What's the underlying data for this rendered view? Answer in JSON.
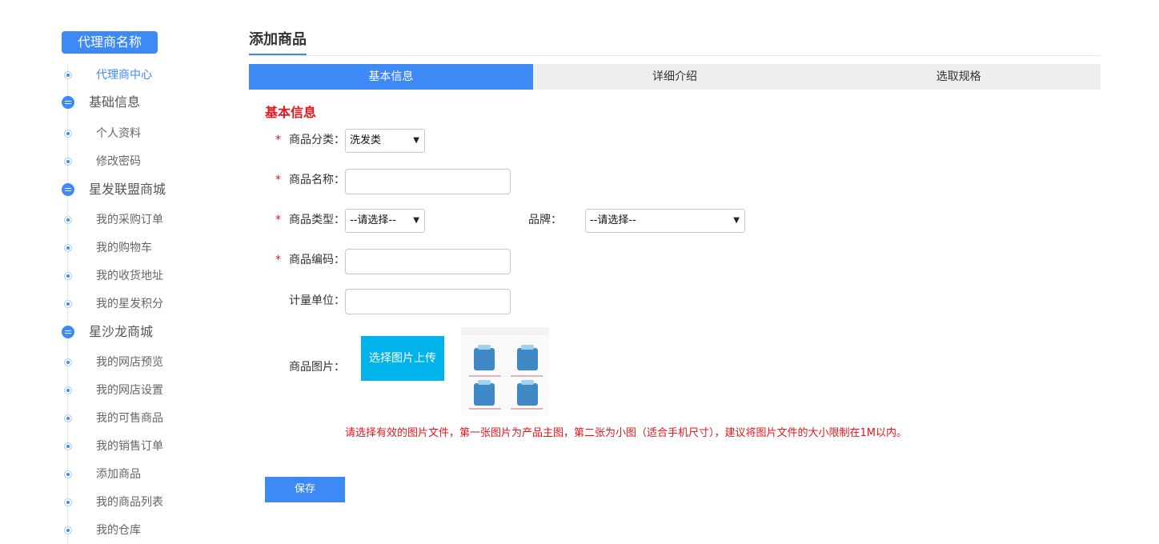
{
  "sidebar": {
    "agent_name": "代理商名称",
    "items": [
      {
        "type": "sub",
        "label": "代理商中心",
        "active": true
      },
      {
        "type": "section",
        "label": "基础信息"
      },
      {
        "type": "sub",
        "label": "个人资料"
      },
      {
        "type": "sub",
        "label": "修改密码"
      },
      {
        "type": "section",
        "label": "星发联盟商城"
      },
      {
        "type": "sub",
        "label": "我的采购订单"
      },
      {
        "type": "sub",
        "label": "我的购物车"
      },
      {
        "type": "sub",
        "label": "我的收货地址"
      },
      {
        "type": "sub",
        "label": "我的星发积分"
      },
      {
        "type": "section",
        "label": "星沙龙商城"
      },
      {
        "type": "sub",
        "label": "我的网店预览"
      },
      {
        "type": "sub",
        "label": "我的网店设置"
      },
      {
        "type": "sub",
        "label": "我的可售商品"
      },
      {
        "type": "sub",
        "label": "我的销售订单"
      },
      {
        "type": "sub",
        "label": "添加商品"
      },
      {
        "type": "sub",
        "label": "我的商品列表"
      },
      {
        "type": "sub",
        "label": "我的仓库"
      }
    ]
  },
  "main": {
    "page_title": "添加商品",
    "tabs": [
      {
        "label": "基本信息",
        "active": true
      },
      {
        "label": "详细介绍",
        "active": false
      },
      {
        "label": "选取规格",
        "active": false
      }
    ],
    "section_title": "基本信息",
    "form": {
      "required_mark": "*",
      "category": {
        "label": "商品分类：",
        "value": "洗发类"
      },
      "name": {
        "label": "商品名称：",
        "value": ""
      },
      "type": {
        "label": "商品类型：",
        "value": "--请选择--"
      },
      "brand": {
        "label": "品牌：",
        "value": "--请选择--"
      },
      "code": {
        "label": "商品编码：",
        "value": ""
      },
      "unit": {
        "label": "计量单位：",
        "value": ""
      },
      "image": {
        "label": "商品图片：",
        "upload_label": "选择图片上传"
      }
    },
    "hint": "请选择有效的图片文件，第一张图片为产品主图，第二张为小图（适合手机尺寸），建议将图片文件的大小限制在1M以内。",
    "save_label": "保存"
  },
  "colors": {
    "accent": "#3d8af7",
    "upload": "#00b3ea",
    "warning": "#e4161b"
  }
}
